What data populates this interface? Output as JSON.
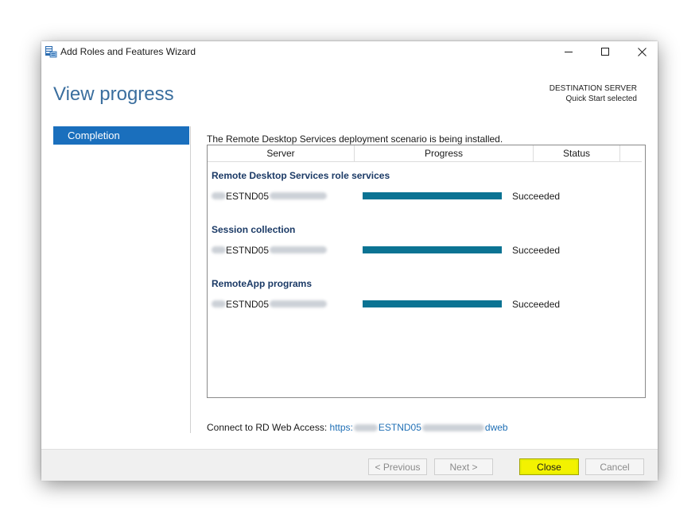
{
  "window": {
    "title": "Add Roles and Features Wizard",
    "icon": "server-manager-wizard-icon"
  },
  "header": {
    "page_title": "View progress",
    "destination_label": "DESTINATION SERVER",
    "destination_value": "Quick Start selected"
  },
  "nav": {
    "items": [
      {
        "label": "Completion",
        "selected": true
      }
    ]
  },
  "main": {
    "intro": "The Remote Desktop Services deployment scenario is being installed.",
    "columns": [
      "Server",
      "Progress",
      "Status"
    ],
    "groups": [
      {
        "title": "Remote Desktop Services role services",
        "server": "ESTND05",
        "progress": 1.0,
        "status": "Succeeded"
      },
      {
        "title": "Session collection",
        "server": "ESTND05",
        "progress": 1.0,
        "status": "Succeeded"
      },
      {
        "title": "RemoteApp programs",
        "server": "ESTND05",
        "progress": 1.0,
        "status": "Succeeded"
      }
    ],
    "connect_label": "Connect to RD Web Access:",
    "connect_link_prefix": "https:",
    "connect_link_host": "ESTND05",
    "connect_link_suffix": "dweb"
  },
  "footer": {
    "previous_label": "< Previous",
    "next_label": "Next >",
    "close_label": "Close",
    "cancel_label": "Cancel"
  },
  "colors": {
    "title_blue": "#3a6e9e",
    "nav_selected": "#1a6fbd",
    "progress_fill": "#0b7393",
    "group_title": "#1b3a66",
    "close_highlight": "#f3f200"
  }
}
